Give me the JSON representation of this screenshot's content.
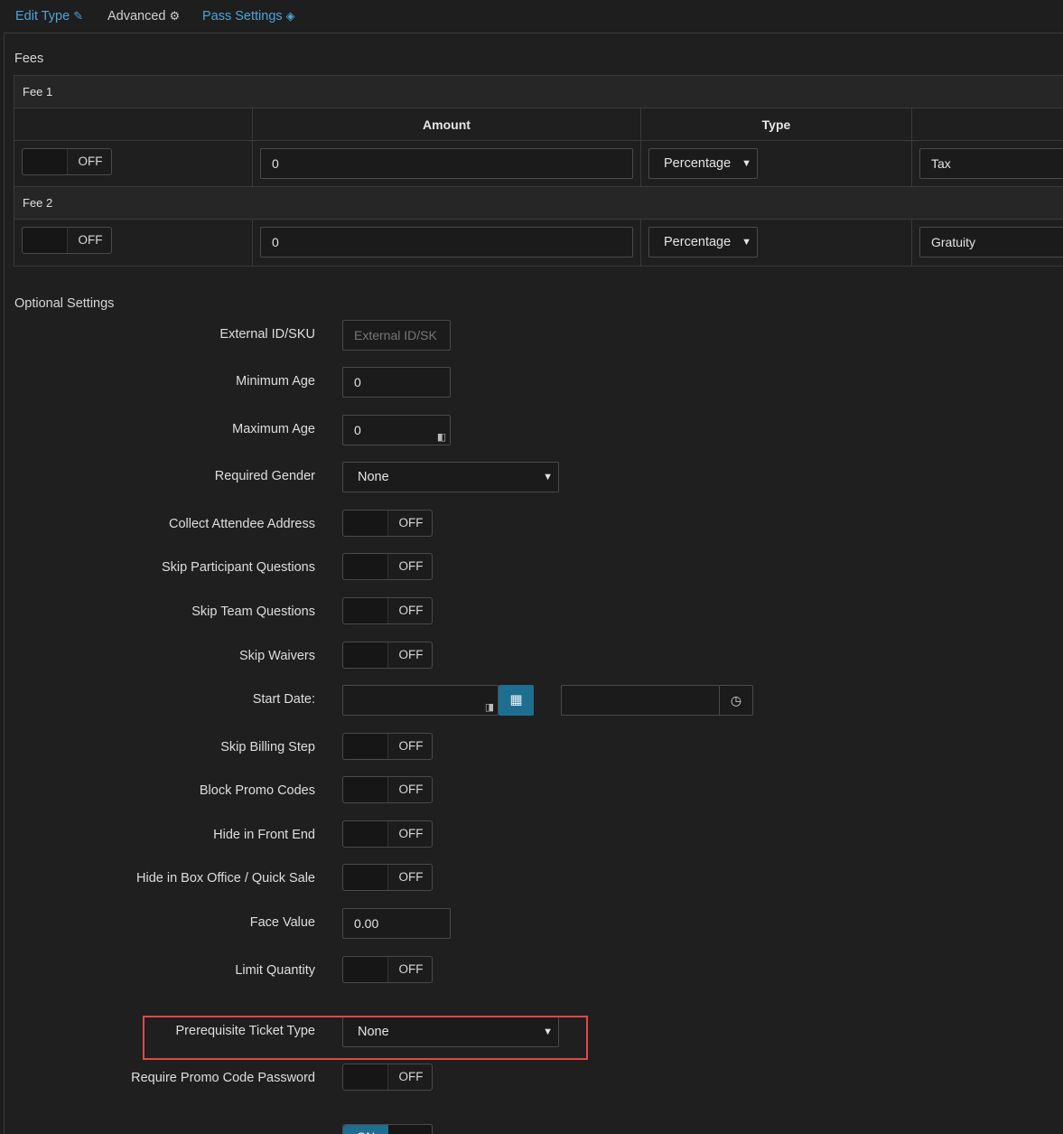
{
  "tabs": {
    "edit_type": "Edit Type",
    "advanced": "Advanced",
    "pass_settings": "Pass Settings"
  },
  "fees": {
    "section_title": "Fees",
    "columns": {
      "amount": "Amount",
      "type": "Type"
    },
    "fee1": {
      "title": "Fee 1",
      "toggle": "OFF",
      "amount": "0",
      "type": "Percentage",
      "name": "Tax"
    },
    "fee2": {
      "title": "Fee 2",
      "toggle": "OFF",
      "amount": "0",
      "type": "Percentage",
      "name": "Gratuity"
    }
  },
  "optional": {
    "section_title": "Optional Settings",
    "external_id": {
      "label": "External ID/SKU",
      "placeholder": "External ID/SK"
    },
    "min_age": {
      "label": "Minimum Age",
      "value": "0"
    },
    "max_age": {
      "label": "Maximum Age",
      "value": "0"
    },
    "gender": {
      "label": "Required Gender",
      "value": "None"
    },
    "collect_address": {
      "label": "Collect Attendee Address",
      "toggle": "OFF"
    },
    "skip_participant": {
      "label": "Skip Participant Questions",
      "toggle": "OFF"
    },
    "skip_team": {
      "label": "Skip Team Questions",
      "toggle": "OFF"
    },
    "skip_waivers": {
      "label": "Skip Waivers",
      "toggle": "OFF"
    },
    "start_date": {
      "label": "Start Date:"
    },
    "skip_billing": {
      "label": "Skip Billing Step",
      "toggle": "OFF"
    },
    "block_promo": {
      "label": "Block Promo Codes",
      "toggle": "OFF"
    },
    "hide_front": {
      "label": "Hide in Front End",
      "toggle": "OFF"
    },
    "hide_box": {
      "label": "Hide in Box Office / Quick Sale",
      "toggle": "OFF"
    },
    "face_value": {
      "label": "Face Value",
      "value": "0.00"
    },
    "limit_qty": {
      "label": "Limit Quantity",
      "toggle": "OFF"
    },
    "prereq": {
      "label": "Prerequisite Ticket Type",
      "value": "None"
    },
    "require_promo": {
      "label": "Require Promo Code Password",
      "toggle": "OFF"
    },
    "last_toggle": {
      "toggle": "ON"
    }
  },
  "colors": {
    "accent": "#1e6f8f",
    "link": "#4fa3d9",
    "highlight": "#e0474b"
  }
}
